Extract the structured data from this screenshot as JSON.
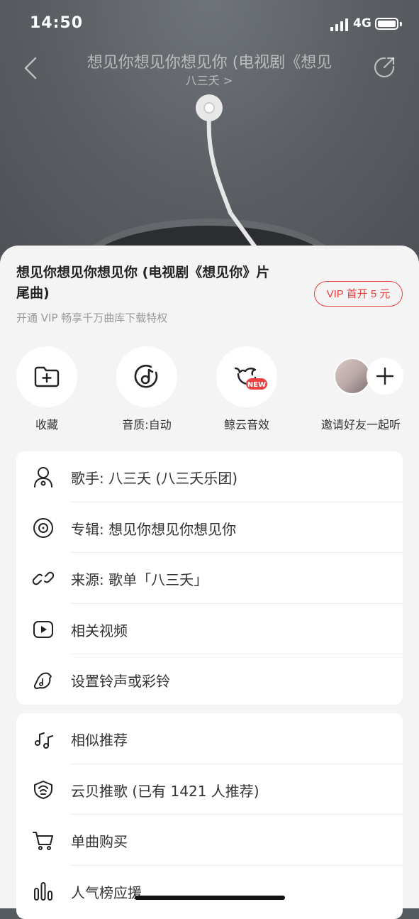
{
  "status": {
    "time": "14:50",
    "network": "4G"
  },
  "header": {
    "title": "想见你想见你想见你 (电视剧《想见",
    "artist": "八三夭 >"
  },
  "song": {
    "title": "想见你想见你想见你 (电视剧《想见你》片尾曲)",
    "vip_button": "VIP 首开 5 元",
    "vip_subtitle": "开通 VIP 畅享千万曲库下载特权"
  },
  "actions": [
    {
      "label": "收藏",
      "icon": "folder-add-icon"
    },
    {
      "label": "音质:自动",
      "icon": "music-quality-icon"
    },
    {
      "label": "鲸云音效",
      "icon": "whale-sound-effect-icon",
      "badge": "NEW"
    },
    {
      "label": "邀请好友一起听",
      "icon": "invite-friend-icon"
    }
  ],
  "info_card": [
    {
      "label": "歌手:  八三夭 (八三夭乐团)",
      "icon": "singer-icon"
    },
    {
      "label": "专辑:  想见你想见你想见你",
      "icon": "album-icon"
    },
    {
      "label": "来源:  歌单「八三夭」",
      "icon": "link-icon"
    },
    {
      "label": "相关视频",
      "icon": "video-icon"
    },
    {
      "label": "设置铃声或彩铃",
      "icon": "ringtone-icon"
    }
  ],
  "more_card": [
    {
      "label": "相似推荐",
      "icon": "similar-music-icon"
    },
    {
      "label": "云贝推歌 (已有 1421 人推荐)",
      "icon": "cloud-coin-icon"
    },
    {
      "label": "单曲购买",
      "icon": "cart-icon"
    },
    {
      "label": "人气榜应援",
      "icon": "chart-bars-icon"
    }
  ],
  "colors": {
    "accent": "#ec4141",
    "badge": "#ec4141"
  }
}
